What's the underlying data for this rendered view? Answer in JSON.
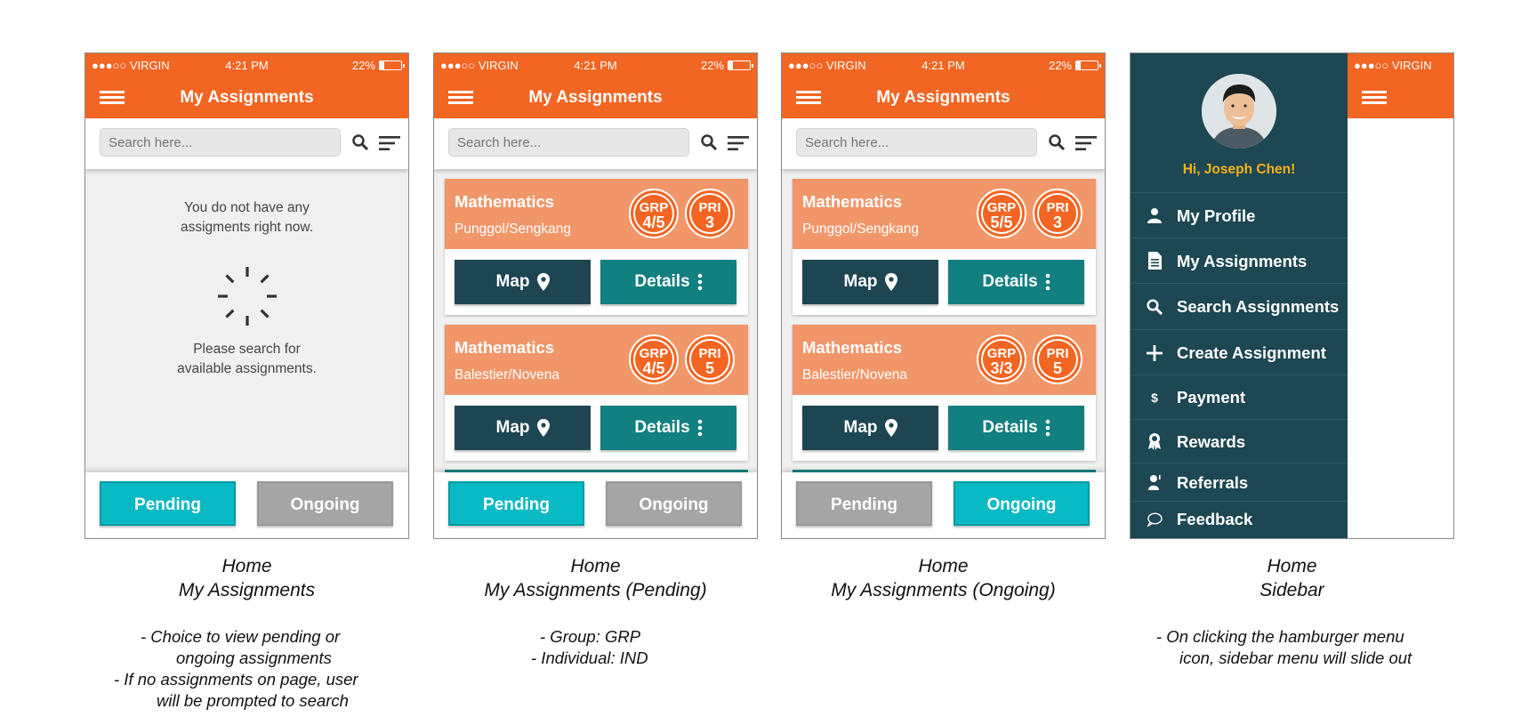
{
  "status_bar": {
    "carrier": "●●●○○ VIRGIN",
    "time": "4:21 PM",
    "battery_text": "22%",
    "battery_level": 0.22
  },
  "app_bar": {
    "title": "My Assignments"
  },
  "search": {
    "placeholder": "Search here..."
  },
  "empty_state": {
    "line1": "You do not have any",
    "line2": "assigments right now.",
    "line3": "Please search for",
    "line4": "available assignments."
  },
  "tabs": {
    "pending": "Pending",
    "ongoing": "Ongoing"
  },
  "card_buttons": {
    "map": "Map",
    "details": "Details"
  },
  "screens": [
    {
      "caption_line1": "Home",
      "caption_line2": "My Assignments",
      "notes": [
        "-  Choice to view pending or",
        "ongoing assignments",
        "-  If no assignments on page, user",
        "will be prompted to search"
      ]
    },
    {
      "caption_line1": "Home",
      "caption_line2": "My Assignments (Pending)",
      "notes": [
        "-  Group: GRP",
        "-  Individual: IND"
      ],
      "cards": [
        {
          "subject": "Mathematics",
          "location": "Punggol/Sengkang",
          "grp_label": "GRP",
          "grp_value": "4/5",
          "pri_label": "PRI",
          "pri_value": "3"
        },
        {
          "subject": "Mathematics",
          "location": "Balestier/Novena",
          "grp_label": "GRP",
          "grp_value": "4/5",
          "pri_label": "PRI",
          "pri_value": "5"
        }
      ]
    },
    {
      "caption_line1": "Home",
      "caption_line2": "My Assignments (Ongoing)",
      "cards": [
        {
          "subject": "Mathematics",
          "location": "Punggol/Sengkang",
          "grp_label": "GRP",
          "grp_value": "5/5",
          "pri_label": "PRI",
          "pri_value": "3"
        },
        {
          "subject": "Mathematics",
          "location": "Balestier/Novena",
          "grp_label": "GRP",
          "grp_value": "3/3",
          "pri_label": "PRI",
          "pri_value": "5"
        }
      ]
    },
    {
      "caption_line1": "Home",
      "caption_line2": "Sidebar",
      "notes": [
        "-  On clicking the hamburger menu",
        "icon, sidebar menu will slide out"
      ]
    }
  ],
  "sidebar": {
    "greeting": "Hi, Joseph Chen!",
    "items": [
      {
        "label": "My Profile",
        "icon": "user-icon"
      },
      {
        "label": "My Assignments",
        "icon": "document-icon"
      },
      {
        "label": "Search Assignments",
        "icon": "search-icon"
      },
      {
        "label": "Create Assignment",
        "icon": "plus-icon"
      },
      {
        "label": "Payment",
        "icon": "dollar-icon"
      },
      {
        "label": "Rewards",
        "icon": "award-icon"
      },
      {
        "label": "Referrals",
        "icon": "referral-icon"
      },
      {
        "label": "Feedback",
        "icon": "speech-bubble-icon"
      }
    ]
  },
  "colors": {
    "brand_orange": "#f26522",
    "card_header": "#f19669",
    "active_tab": "#09b9c4",
    "inactive_tab": "#a5a5a5",
    "map_button": "#1e4652",
    "details_button": "#127f81",
    "sidebar_bg": "#1d4752",
    "greeting": "#f7b21a"
  }
}
